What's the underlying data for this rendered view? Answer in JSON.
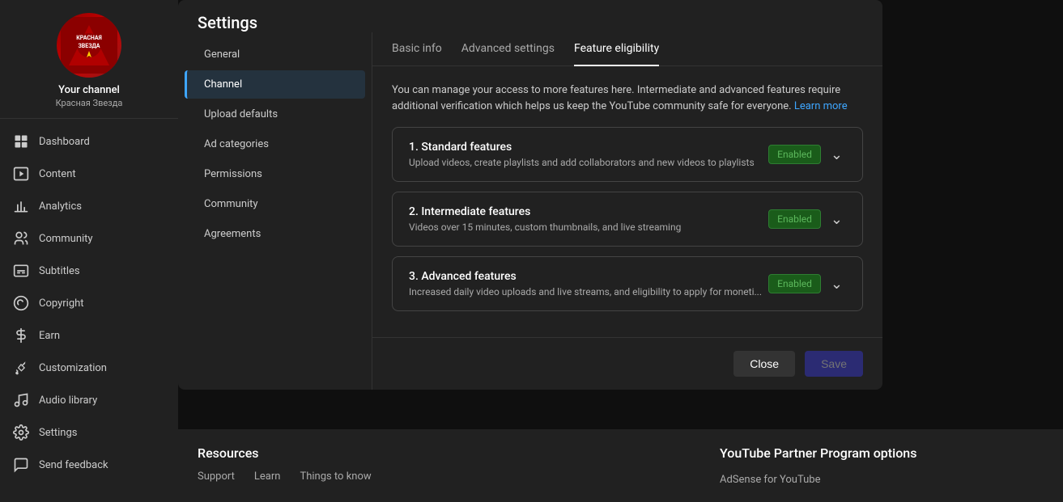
{
  "sidebar": {
    "channel": {
      "name": "Your channel",
      "subtitle": "Красная Звезда",
      "avatar_text": "КРАСНАЯ\nЗВЕЗДА"
    },
    "nav_items": [
      {
        "id": "dashboard",
        "label": "Dashboard",
        "icon": "grid"
      },
      {
        "id": "content",
        "label": "Content",
        "icon": "play"
      },
      {
        "id": "analytics",
        "label": "Analytics",
        "icon": "chart"
      },
      {
        "id": "community",
        "label": "Community",
        "icon": "people"
      },
      {
        "id": "subtitles",
        "label": "Subtitles",
        "icon": "subtitles"
      },
      {
        "id": "copyright",
        "label": "Copyright",
        "icon": "copyright"
      },
      {
        "id": "earn",
        "label": "Earn",
        "icon": "dollar"
      },
      {
        "id": "customization",
        "label": "Customization",
        "icon": "brush"
      },
      {
        "id": "audio-library",
        "label": "Audio library",
        "icon": "music"
      },
      {
        "id": "settings",
        "label": "Settings",
        "icon": "gear"
      },
      {
        "id": "send-feedback",
        "label": "Send feedback",
        "icon": "feedback"
      }
    ]
  },
  "modal": {
    "title": "Settings",
    "nav_items": [
      {
        "id": "general",
        "label": "General"
      },
      {
        "id": "channel",
        "label": "Channel",
        "active": true
      },
      {
        "id": "upload-defaults",
        "label": "Upload defaults"
      },
      {
        "id": "ad-categories",
        "label": "Ad categories"
      },
      {
        "id": "permissions",
        "label": "Permissions"
      },
      {
        "id": "community",
        "label": "Community"
      },
      {
        "id": "agreements",
        "label": "Agreements"
      }
    ],
    "tabs": [
      {
        "id": "basic-info",
        "label": "Basic info"
      },
      {
        "id": "advanced-settings",
        "label": "Advanced settings"
      },
      {
        "id": "feature-eligibility",
        "label": "Feature eligibility",
        "active": true
      }
    ],
    "feature_intro": "You can manage your access to more features here. Intermediate and advanced features require additional verification which helps us keep the YouTube community safe for everyone.",
    "learn_more": "Learn more",
    "features": [
      {
        "id": "standard",
        "title": "1. Standard features",
        "description": "Upload videos, create playlists and add collaborators and new videos to playlists",
        "status": "Enabled"
      },
      {
        "id": "intermediate",
        "title": "2. Intermediate features",
        "description": "Videos over 15 minutes, custom thumbnails, and live streaming",
        "status": "Enabled"
      },
      {
        "id": "advanced",
        "title": "3. Advanced features",
        "description": "Increased daily video uploads and live streams, and eligibility to apply for moneti...",
        "status": "Enabled"
      }
    ],
    "buttons": {
      "close": "Close",
      "save": "Save"
    }
  },
  "bottom": {
    "resources_title": "Resources",
    "resources_links": [
      "Support",
      "Learn",
      "Things to know"
    ],
    "yt_partner_title": "YouTube Partner Program options",
    "yt_partner_links": [
      "AdSense for YouTube"
    ]
  }
}
